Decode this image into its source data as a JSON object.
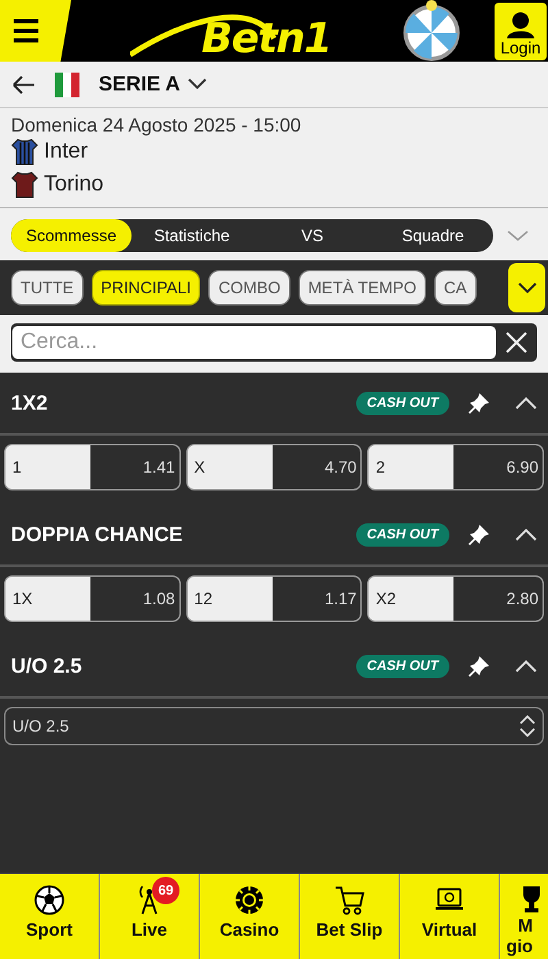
{
  "header": {
    "logo": "Betn1",
    "login": "Login"
  },
  "breadcrumb": {
    "league": "SERIE A"
  },
  "match": {
    "datetime": "Domenica 24 Agosto 2025 - 15:00",
    "teams": [
      {
        "name": "Inter",
        "color": "#2a4f9e"
      },
      {
        "name": "Torino",
        "color": "#6e1a1a"
      }
    ]
  },
  "tabs": [
    {
      "label": "Scommesse",
      "selected": true
    },
    {
      "label": "Statistiche",
      "selected": false
    },
    {
      "label": "VS",
      "selected": false
    },
    {
      "label": "Squadre",
      "selected": false
    }
  ],
  "filters": [
    {
      "label": "TUTTE",
      "selected": false
    },
    {
      "label": "PRINCIPALI",
      "selected": true
    },
    {
      "label": "COMBO",
      "selected": false
    },
    {
      "label": "METÀ TEMPO",
      "selected": false
    },
    {
      "label": "CA",
      "selected": false
    }
  ],
  "search": {
    "placeholder": "Cerca..."
  },
  "markets": [
    {
      "title": "1X2",
      "badge": "CASH OUT",
      "kind": "odds",
      "odds": [
        {
          "label": "1",
          "value": "1.41"
        },
        {
          "label": "X",
          "value": "4.70"
        },
        {
          "label": "2",
          "value": "6.90"
        }
      ]
    },
    {
      "title": "DOPPIA CHANCE",
      "badge": "CASH OUT",
      "kind": "odds",
      "odds": [
        {
          "label": "1X",
          "value": "1.08"
        },
        {
          "label": "12",
          "value": "1.17"
        },
        {
          "label": "X2",
          "value": "2.80"
        }
      ]
    },
    {
      "title": "U/O 2.5",
      "badge": "CASH OUT",
      "kind": "select",
      "select": "U/O 2.5"
    }
  ],
  "nav": [
    {
      "label": "Sport",
      "kind": "ball"
    },
    {
      "label": "Live",
      "kind": "antenna",
      "badge": "69"
    },
    {
      "label": "Casino",
      "kind": "chip"
    },
    {
      "label": "Bet Slip",
      "kind": "cart"
    },
    {
      "label": "Virtual",
      "kind": "screen"
    },
    {
      "label": "M gio",
      "kind": "trophy"
    }
  ]
}
